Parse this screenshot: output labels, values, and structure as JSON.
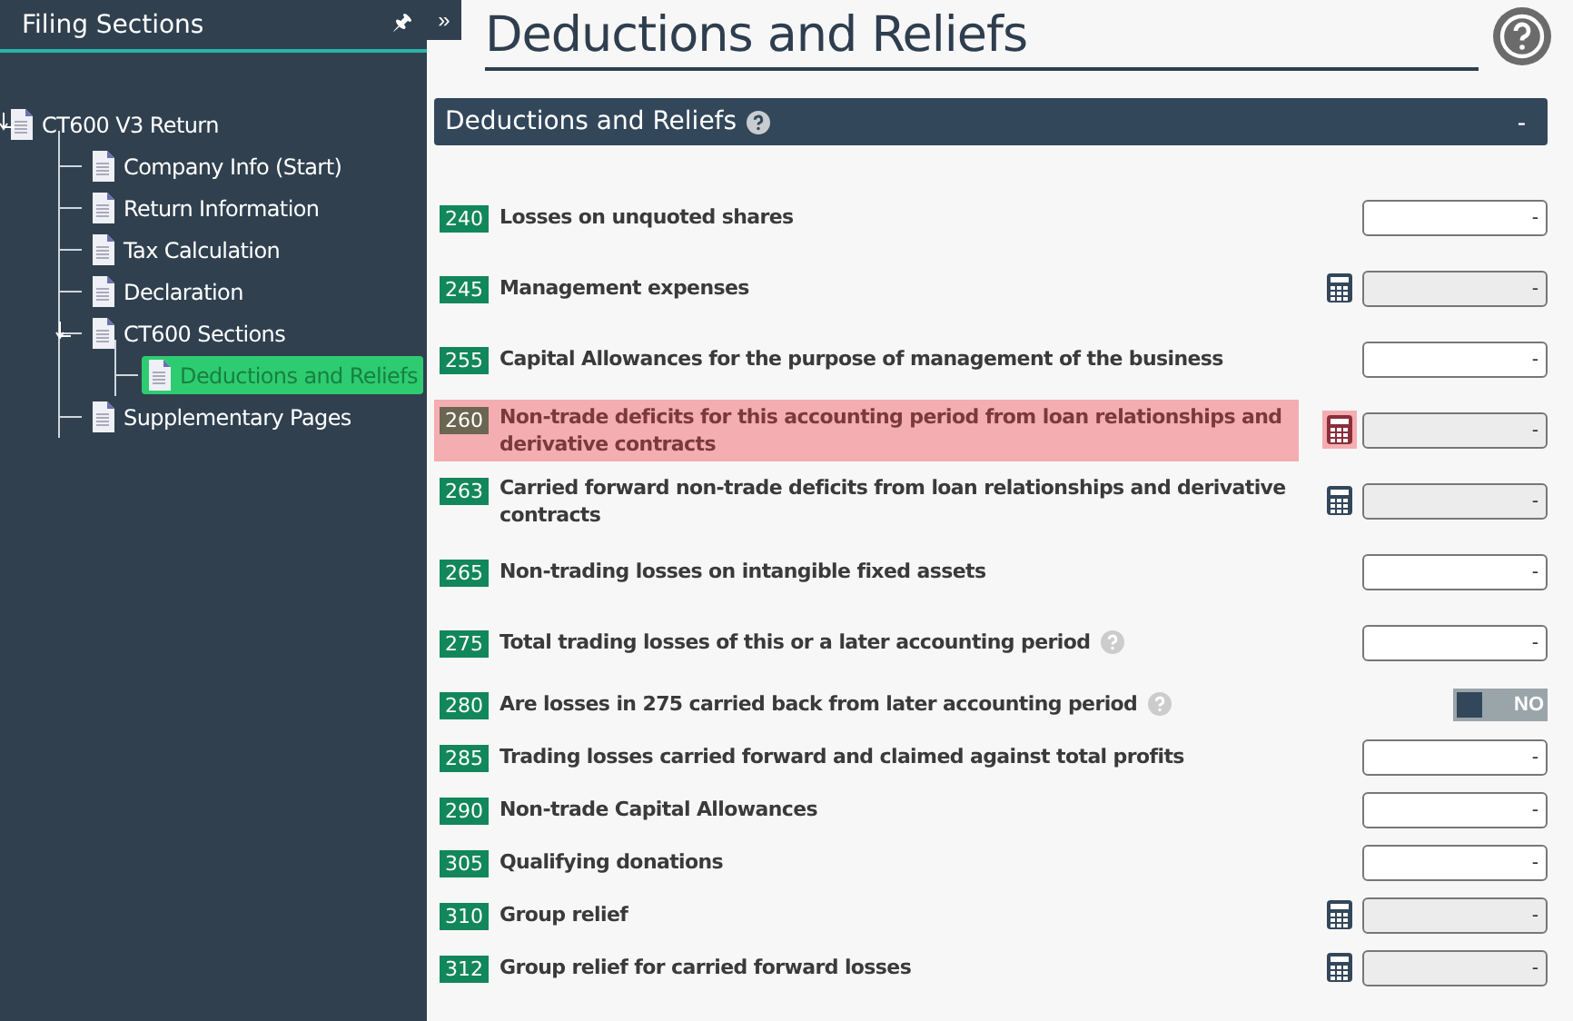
{
  "sidebar": {
    "title": "Filing Sections",
    "pin_glyph": "🖈",
    "collapse_glyph": "»",
    "tree": [
      {
        "label": "CT600 V3 Return",
        "expanded": true,
        "selected": false,
        "children": [
          {
            "label": "Company Info (Start)",
            "selected": false
          },
          {
            "label": "Return Information",
            "selected": false
          },
          {
            "label": "Tax Calculation",
            "selected": false
          },
          {
            "label": "Declaration",
            "selected": false
          },
          {
            "label": "CT600 Sections",
            "expanded": true,
            "selected": false,
            "children": [
              {
                "label": "Deductions and Reliefs",
                "selected": true
              }
            ]
          },
          {
            "label": "Supplementary Pages",
            "selected": false
          }
        ]
      }
    ]
  },
  "page": {
    "title": "Deductions and Reliefs"
  },
  "section": {
    "title": "Deductions and Reliefs",
    "toggle": "-",
    "rows": [
      {
        "code": "240",
        "label": "Losses on unquoted shares",
        "kind": "input",
        "value": "-",
        "error": false,
        "help": false
      },
      {
        "code": "245",
        "label": "Management expenses",
        "kind": "calculated",
        "value": "-",
        "error": false,
        "help": false
      },
      {
        "code": "255",
        "label": "Capital Allowances for the purpose of management of the business",
        "kind": "input",
        "value": "-",
        "error": false,
        "help": false
      },
      {
        "code": "260",
        "label": "Non-trade deficits for this accounting period from loan relationships and derivative contracts",
        "kind": "calculated",
        "value": "-",
        "error": true,
        "help": false
      },
      {
        "code": "263",
        "label": "Carried forward non-trade deficits from loan relationships and derivative contracts",
        "kind": "calculated",
        "value": "-",
        "error": false,
        "help": false
      },
      {
        "code": "265",
        "label": "Non-trading losses on intangible fixed assets",
        "kind": "input",
        "value": "-",
        "error": false,
        "help": false
      },
      {
        "code": "275",
        "label": "Total trading losses of this or a later accounting period",
        "kind": "input",
        "value": "-",
        "error": false,
        "help": true
      },
      {
        "code": "280",
        "label": "Are losses in 275 carried back from later accounting period",
        "kind": "toggle",
        "value": "NO",
        "on": false,
        "error": false,
        "help": true
      },
      {
        "code": "285",
        "label": "Trading losses carried forward and claimed against total profits",
        "kind": "input",
        "value": "-",
        "error": false,
        "help": false
      },
      {
        "code": "290",
        "label": "Non-trade Capital Allowances",
        "kind": "input",
        "value": "-",
        "error": false,
        "help": false
      },
      {
        "code": "305",
        "label": "Qualifying donations",
        "kind": "input",
        "value": "-",
        "error": false,
        "help": false
      },
      {
        "code": "310",
        "label": "Group relief",
        "kind": "calculated",
        "value": "-",
        "error": false,
        "help": false
      },
      {
        "code": "312",
        "label": "Group relief for carried forward losses",
        "kind": "calculated",
        "value": "-",
        "error": false,
        "help": false
      }
    ]
  }
}
